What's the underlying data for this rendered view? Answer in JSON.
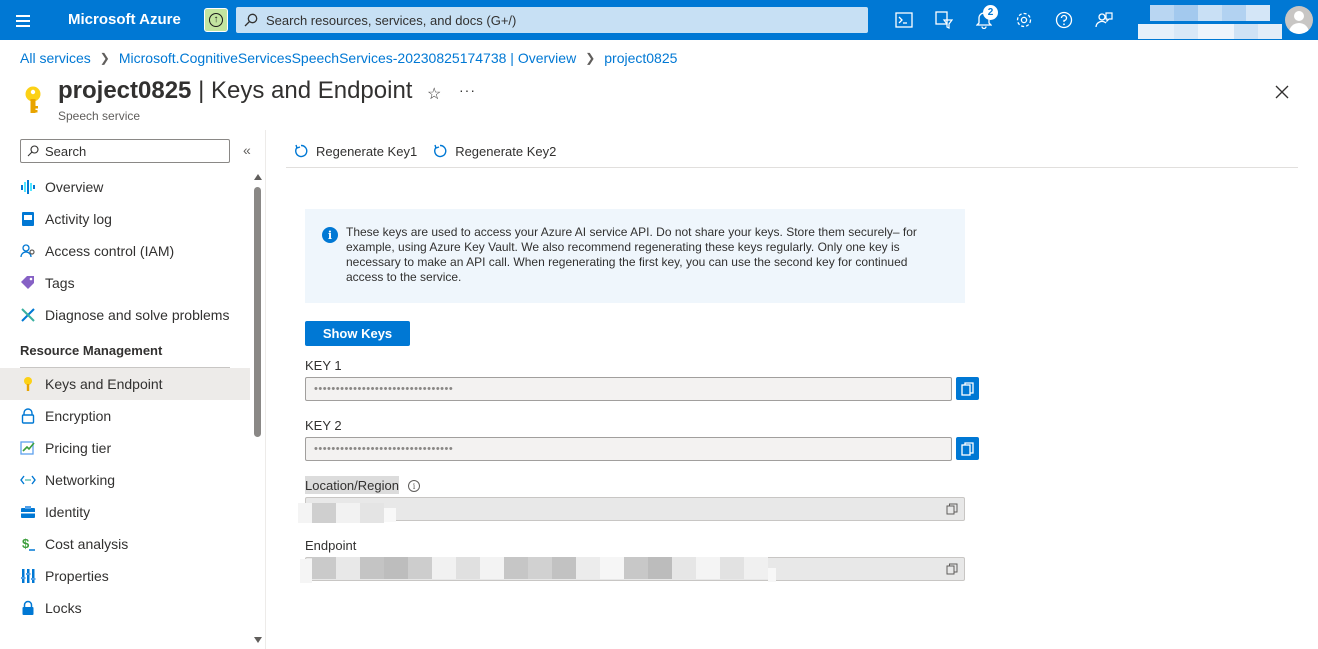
{
  "topbar": {
    "brand": "Microsoft Azure",
    "search_placeholder": "Search resources, services, and docs (G+/)",
    "notifications_count": "2",
    "icons": [
      "cloud-shell-icon",
      "directory-filter-icon",
      "notifications-icon",
      "settings-icon",
      "help-icon",
      "feedback-icon"
    ],
    "accent": "#0078d4"
  },
  "breadcrumb": {
    "items": [
      "All services",
      "Microsoft.CognitiveServicesSpeechServices-20230825174738 | Overview",
      "project0825"
    ]
  },
  "header": {
    "resource_name": "project0825",
    "title_suffix": "| Keys and Endpoint",
    "subtitle": "Speech service",
    "more": "···"
  },
  "nav": {
    "search_placeholder": "Search",
    "collapse_glyph": "«",
    "items_top": [
      {
        "label": "Overview",
        "icon": "overview-icon"
      },
      {
        "label": "Activity log",
        "icon": "activity-log-icon"
      },
      {
        "label": "Access control (IAM)",
        "icon": "access-control-icon"
      },
      {
        "label": "Tags",
        "icon": "tag-icon"
      },
      {
        "label": "Diagnose and solve problems",
        "icon": "diagnose-icon"
      }
    ],
    "section_resource_management": "Resource Management",
    "items_rm": [
      {
        "label": "Keys and Endpoint",
        "icon": "key-icon",
        "active": true
      },
      {
        "label": "Encryption",
        "icon": "lock-icon"
      },
      {
        "label": "Pricing tier",
        "icon": "pricing-icon"
      },
      {
        "label": "Networking",
        "icon": "networking-icon"
      },
      {
        "label": "Identity",
        "icon": "identity-icon"
      },
      {
        "label": "Cost analysis",
        "icon": "cost-icon"
      },
      {
        "label": "Properties",
        "icon": "properties-icon"
      },
      {
        "label": "Locks",
        "icon": "locks-icon"
      }
    ]
  },
  "commands": {
    "regen1": "Regenerate Key1",
    "regen2": "Regenerate Key2"
  },
  "info": {
    "text": "These keys are used to access your Azure AI service API. Do not share your keys. Store them securely– for example, using Azure Key Vault. We also recommend regenerating these keys regularly. Only one key is necessary to make an API call. When regenerating the first key, you can use the second key for continued access to the service."
  },
  "keys": {
    "show_keys_label": "Show Keys",
    "key1_label": "KEY 1",
    "key1_value": "••••••••••••••••••••••••••••••••",
    "key2_label": "KEY 2",
    "key2_value": "••••••••••••••••••••••••••••••••",
    "location_label": "Location/Region",
    "endpoint_label": "Endpoint"
  }
}
